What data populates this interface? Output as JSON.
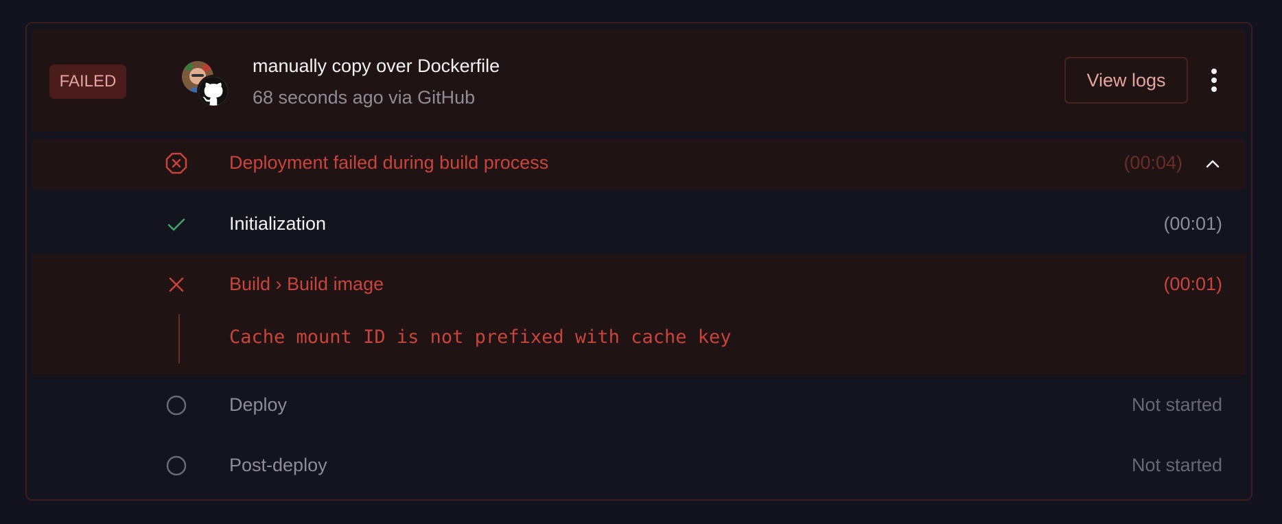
{
  "status_badge": "FAILED",
  "commit": {
    "title": "manually copy over Dockerfile",
    "subtitle": "68 seconds ago via GitHub",
    "avatar_icon": "user-avatar",
    "source_icon": "github-icon"
  },
  "actions": {
    "view_logs": "View logs",
    "more_icon": "kebab-menu-icon"
  },
  "summary": {
    "text": "Deployment failed during build process",
    "duration": "(00:04)",
    "icon": "x-circle-icon",
    "toggle_icon": "chevron-up-icon"
  },
  "steps": [
    {
      "label": "Initialization",
      "time": "(00:01)",
      "status": "success",
      "icon": "check-icon"
    },
    {
      "label": "Build › Build image",
      "time": "(00:01)",
      "status": "failed",
      "icon": "x-icon",
      "error": "Cache mount ID is not prefixed with cache key"
    },
    {
      "label": "Deploy",
      "time": "Not started",
      "status": "pending",
      "icon": "circle-icon"
    },
    {
      "label": "Post-deploy",
      "time": "Not started",
      "status": "pending",
      "icon": "circle-icon"
    }
  ],
  "colors": {
    "background": "#13131f",
    "error": "#c9443a",
    "success": "#3fa66a",
    "badge_bg": "#4a1c1b",
    "muted": "#8e8d96"
  }
}
